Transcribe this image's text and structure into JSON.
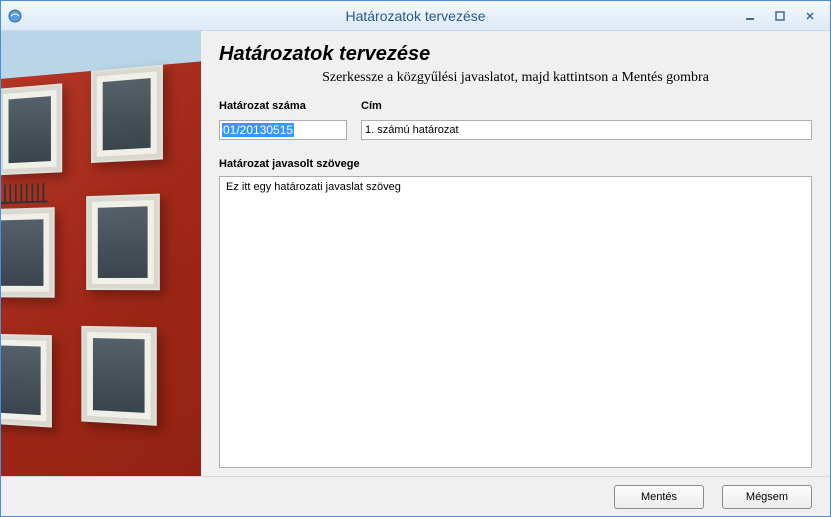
{
  "window": {
    "title": "Határozatok tervezése"
  },
  "main": {
    "heading": "Határozatok tervezése",
    "subtitle": "Szerkessze a közgyűlési javaslatot, majd kattintson a Mentés gombra"
  },
  "form": {
    "number_label": "Határozat száma",
    "number_value": "01/20130515",
    "title_label": "Cím",
    "title_value": "1. számú határozat",
    "body_label": "Határozat javasolt szövege",
    "body_value": "Ez itt egy határozati javaslat szöveg"
  },
  "buttons": {
    "save": "Mentés",
    "cancel": "Mégsem"
  }
}
